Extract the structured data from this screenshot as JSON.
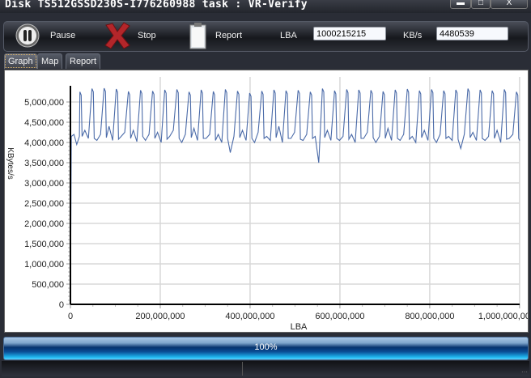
{
  "window": {
    "title": "Disk TS512GSSD230S-I776260988   task : VR-Verify",
    "minimize_icon": "minimize-icon",
    "maximize_icon": "maximize-icon",
    "close_icon": "close-icon"
  },
  "toolbar": {
    "pause_label": "Pause",
    "stop_label": "Stop",
    "report_label": "Report",
    "lba_label": "LBA",
    "lba_value": "1000215215",
    "speed_label": "KB/s",
    "speed_value": "4480539"
  },
  "tabs": [
    {
      "label": "Graph",
      "active": true
    },
    {
      "label": "Map",
      "active": false
    },
    {
      "label": "Report",
      "active": false
    }
  ],
  "progress": {
    "label": "100%",
    "value": 100
  },
  "colors": {
    "series": "#4a6aa8",
    "grid": "#d8d8d8",
    "progress": "#0a4d95"
  },
  "chart_data": {
    "type": "line",
    "xlabel": "LBA",
    "ylabel": "KBytes/s",
    "xlim": [
      0,
      1000215215
    ],
    "ylim": [
      0,
      5400000
    ],
    "x_ticks": [
      "0",
      "200,000,000",
      "400,000,000",
      "600,000,000",
      "800,000,000",
      "1,000,000,000"
    ],
    "x_tick_values": [
      0,
      200000000,
      400000000,
      600000000,
      800000000,
      1000000000
    ],
    "y_ticks": [
      "0",
      "500,000",
      "1,000,000",
      "1,500,000",
      "2,000,000",
      "2,500,000",
      "3,000,000",
      "3,500,000",
      "4,000,000",
      "4,500,000",
      "5,000,000"
    ],
    "y_tick_values": [
      0,
      500000,
      1000000,
      1500000,
      2000000,
      2500000,
      3000000,
      3500000,
      4000000,
      4500000,
      5000000
    ],
    "grid": true,
    "series": [
      {
        "points": [
          [
            0,
            0
          ],
          [
            2000000,
            4150000
          ],
          [
            8000000,
            4200000
          ],
          [
            14000000,
            3950000
          ],
          [
            20000000,
            4150000
          ],
          [
            21000000,
            5250000
          ],
          [
            24000000,
            5170000
          ],
          [
            26000000,
            4150000
          ],
          [
            32000000,
            4300000
          ],
          [
            40000000,
            4100000
          ],
          [
            48000000,
            5330000
          ],
          [
            51000000,
            5250000
          ],
          [
            53000000,
            4100000
          ],
          [
            59000000,
            4050000
          ],
          [
            67000000,
            4200000
          ],
          [
            75000000,
            5340000
          ],
          [
            78000000,
            5260000
          ],
          [
            80000000,
            4120000
          ],
          [
            86000000,
            4400000
          ],
          [
            94000000,
            4050000
          ],
          [
            102000000,
            5320000
          ],
          [
            105000000,
            5240000
          ],
          [
            107000000,
            4080000
          ],
          [
            113000000,
            4150000
          ],
          [
            121000000,
            4250000
          ],
          [
            129000000,
            5260000
          ],
          [
            132000000,
            5180000
          ],
          [
            134000000,
            4100000
          ],
          [
            140000000,
            4300000
          ],
          [
            148000000,
            4020000
          ],
          [
            156000000,
            5290000
          ],
          [
            159000000,
            5210000
          ],
          [
            161000000,
            4150000
          ],
          [
            167000000,
            4050000
          ],
          [
            175000000,
            4200000
          ],
          [
            183000000,
            5270000
          ],
          [
            186000000,
            5190000
          ],
          [
            188000000,
            4100000
          ],
          [
            194000000,
            4250000
          ],
          [
            202000000,
            4000000
          ],
          [
            210000000,
            5300000
          ],
          [
            213000000,
            5220000
          ],
          [
            215000000,
            4080000
          ],
          [
            221000000,
            4150000
          ],
          [
            229000000,
            4300000
          ],
          [
            237000000,
            5310000
          ],
          [
            240000000,
            5230000
          ],
          [
            242000000,
            4100000
          ],
          [
            248000000,
            4000000
          ],
          [
            256000000,
            4200000
          ],
          [
            264000000,
            5250000
          ],
          [
            267000000,
            5170000
          ],
          [
            269000000,
            4120000
          ],
          [
            275000000,
            4350000
          ],
          [
            283000000,
            4050000
          ],
          [
            291000000,
            5300000
          ],
          [
            294000000,
            5220000
          ],
          [
            296000000,
            4100000
          ],
          [
            302000000,
            4100000
          ],
          [
            310000000,
            4200000
          ],
          [
            318000000,
            5260000
          ],
          [
            321000000,
            5180000
          ],
          [
            323000000,
            4050000
          ],
          [
            329000000,
            4200000
          ],
          [
            337000000,
            4000000
          ],
          [
            345000000,
            5310000
          ],
          [
            348000000,
            5230000
          ],
          [
            350000000,
            4100000
          ],
          [
            356000000,
            3750000
          ],
          [
            364000000,
            4150000
          ],
          [
            372000000,
            5270000
          ],
          [
            375000000,
            5190000
          ],
          [
            377000000,
            4120000
          ],
          [
            383000000,
            4300000
          ],
          [
            391000000,
            4050000
          ],
          [
            399000000,
            5220000
          ],
          [
            402000000,
            5140000
          ],
          [
            404000000,
            4100000
          ],
          [
            410000000,
            4000000
          ],
          [
            418000000,
            4250000
          ],
          [
            426000000,
            5270000
          ],
          [
            429000000,
            5190000
          ],
          [
            431000000,
            4100000
          ],
          [
            437000000,
            4150000
          ],
          [
            445000000,
            4050000
          ],
          [
            453000000,
            5300000
          ],
          [
            456000000,
            5220000
          ],
          [
            458000000,
            4120000
          ],
          [
            464000000,
            4400000
          ],
          [
            472000000,
            4000000
          ],
          [
            480000000,
            5280000
          ],
          [
            483000000,
            5200000
          ],
          [
            485000000,
            4100000
          ],
          [
            491000000,
            4100000
          ],
          [
            499000000,
            4250000
          ],
          [
            507000000,
            5290000
          ],
          [
            510000000,
            5210000
          ],
          [
            512000000,
            4080000
          ],
          [
            518000000,
            4050000
          ],
          [
            526000000,
            4200000
          ],
          [
            534000000,
            5250000
          ],
          [
            537000000,
            5170000
          ],
          [
            539000000,
            4100000
          ],
          [
            545000000,
            4150000
          ],
          [
            553000000,
            3500000
          ],
          [
            561000000,
            5330000
          ],
          [
            564000000,
            5250000
          ],
          [
            566000000,
            4120000
          ],
          [
            572000000,
            4300000
          ],
          [
            580000000,
            4050000
          ],
          [
            588000000,
            5280000
          ],
          [
            591000000,
            5200000
          ],
          [
            593000000,
            4100000
          ],
          [
            599000000,
            4050000
          ],
          [
            607000000,
            4150000
          ],
          [
            615000000,
            5310000
          ],
          [
            618000000,
            5230000
          ],
          [
            620000000,
            4080000
          ],
          [
            626000000,
            4200000
          ],
          [
            634000000,
            4000000
          ],
          [
            642000000,
            5300000
          ],
          [
            645000000,
            5220000
          ],
          [
            647000000,
            4100000
          ],
          [
            653000000,
            4100000
          ],
          [
            661000000,
            4250000
          ],
          [
            669000000,
            5290000
          ],
          [
            672000000,
            5210000
          ],
          [
            674000000,
            4120000
          ],
          [
            680000000,
            4000000
          ],
          [
            688000000,
            4150000
          ],
          [
            696000000,
            5260000
          ],
          [
            699000000,
            5180000
          ],
          [
            701000000,
            4100000
          ],
          [
            707000000,
            4350000
          ],
          [
            715000000,
            4050000
          ],
          [
            723000000,
            5300000
          ],
          [
            726000000,
            5220000
          ],
          [
            728000000,
            4100000
          ],
          [
            734000000,
            4050000
          ],
          [
            742000000,
            4200000
          ],
          [
            750000000,
            5320000
          ],
          [
            753000000,
            5240000
          ],
          [
            755000000,
            4080000
          ],
          [
            761000000,
            4150000
          ],
          [
            769000000,
            4000000
          ],
          [
            777000000,
            5280000
          ],
          [
            780000000,
            5200000
          ],
          [
            782000000,
            4120000
          ],
          [
            788000000,
            4300000
          ],
          [
            796000000,
            4050000
          ],
          [
            804000000,
            5310000
          ],
          [
            807000000,
            5230000
          ],
          [
            809000000,
            4100000
          ],
          [
            815000000,
            4000000
          ],
          [
            823000000,
            4200000
          ],
          [
            831000000,
            5280000
          ],
          [
            834000000,
            5200000
          ],
          [
            836000000,
            4100000
          ],
          [
            842000000,
            4150000
          ],
          [
            850000000,
            4050000
          ],
          [
            858000000,
            5300000
          ],
          [
            861000000,
            5220000
          ],
          [
            863000000,
            4080000
          ],
          [
            869000000,
            3850000
          ],
          [
            877000000,
            4200000
          ],
          [
            885000000,
            5330000
          ],
          [
            888000000,
            5250000
          ],
          [
            890000000,
            4120000
          ],
          [
            896000000,
            4250000
          ],
          [
            904000000,
            4050000
          ],
          [
            912000000,
            5300000
          ],
          [
            915000000,
            5220000
          ],
          [
            917000000,
            4100000
          ],
          [
            923000000,
            4050000
          ],
          [
            931000000,
            4150000
          ],
          [
            939000000,
            5280000
          ],
          [
            942000000,
            5200000
          ],
          [
            944000000,
            4100000
          ],
          [
            950000000,
            4300000
          ],
          [
            958000000,
            4000000
          ],
          [
            966000000,
            5310000
          ],
          [
            969000000,
            5230000
          ],
          [
            971000000,
            4080000
          ],
          [
            977000000,
            4100000
          ],
          [
            985000000,
            4200000
          ],
          [
            993000000,
            5250000
          ],
          [
            996000000,
            5170000
          ],
          [
            998000000,
            4100000
          ],
          [
            1000215215,
            4050000
          ]
        ]
      }
    ]
  }
}
